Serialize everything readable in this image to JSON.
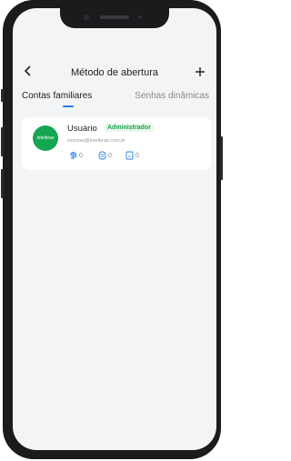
{
  "header": {
    "back_icon": "chevron-left-icon",
    "title": "Método de abertura",
    "add_icon": "plus-icon"
  },
  "tabs": [
    {
      "label": "Contas familiares",
      "active": true
    },
    {
      "label": "Senhas dinâmicas",
      "active": false
    }
  ],
  "user_card": {
    "avatar_text": "intelbras",
    "name": "Usuário",
    "role_badge": "Administrador",
    "email": "xxxxxxx@intelbras.com.br",
    "stats": [
      {
        "icon": "fingerprint-icon",
        "count": "0"
      },
      {
        "icon": "face-icon",
        "count": "0"
      },
      {
        "icon": "card-icon",
        "count": "0"
      }
    ]
  },
  "colors": {
    "accent": "#2a7fe0",
    "avatar_bg": "#14a650",
    "badge_green": "#1aa34a"
  }
}
